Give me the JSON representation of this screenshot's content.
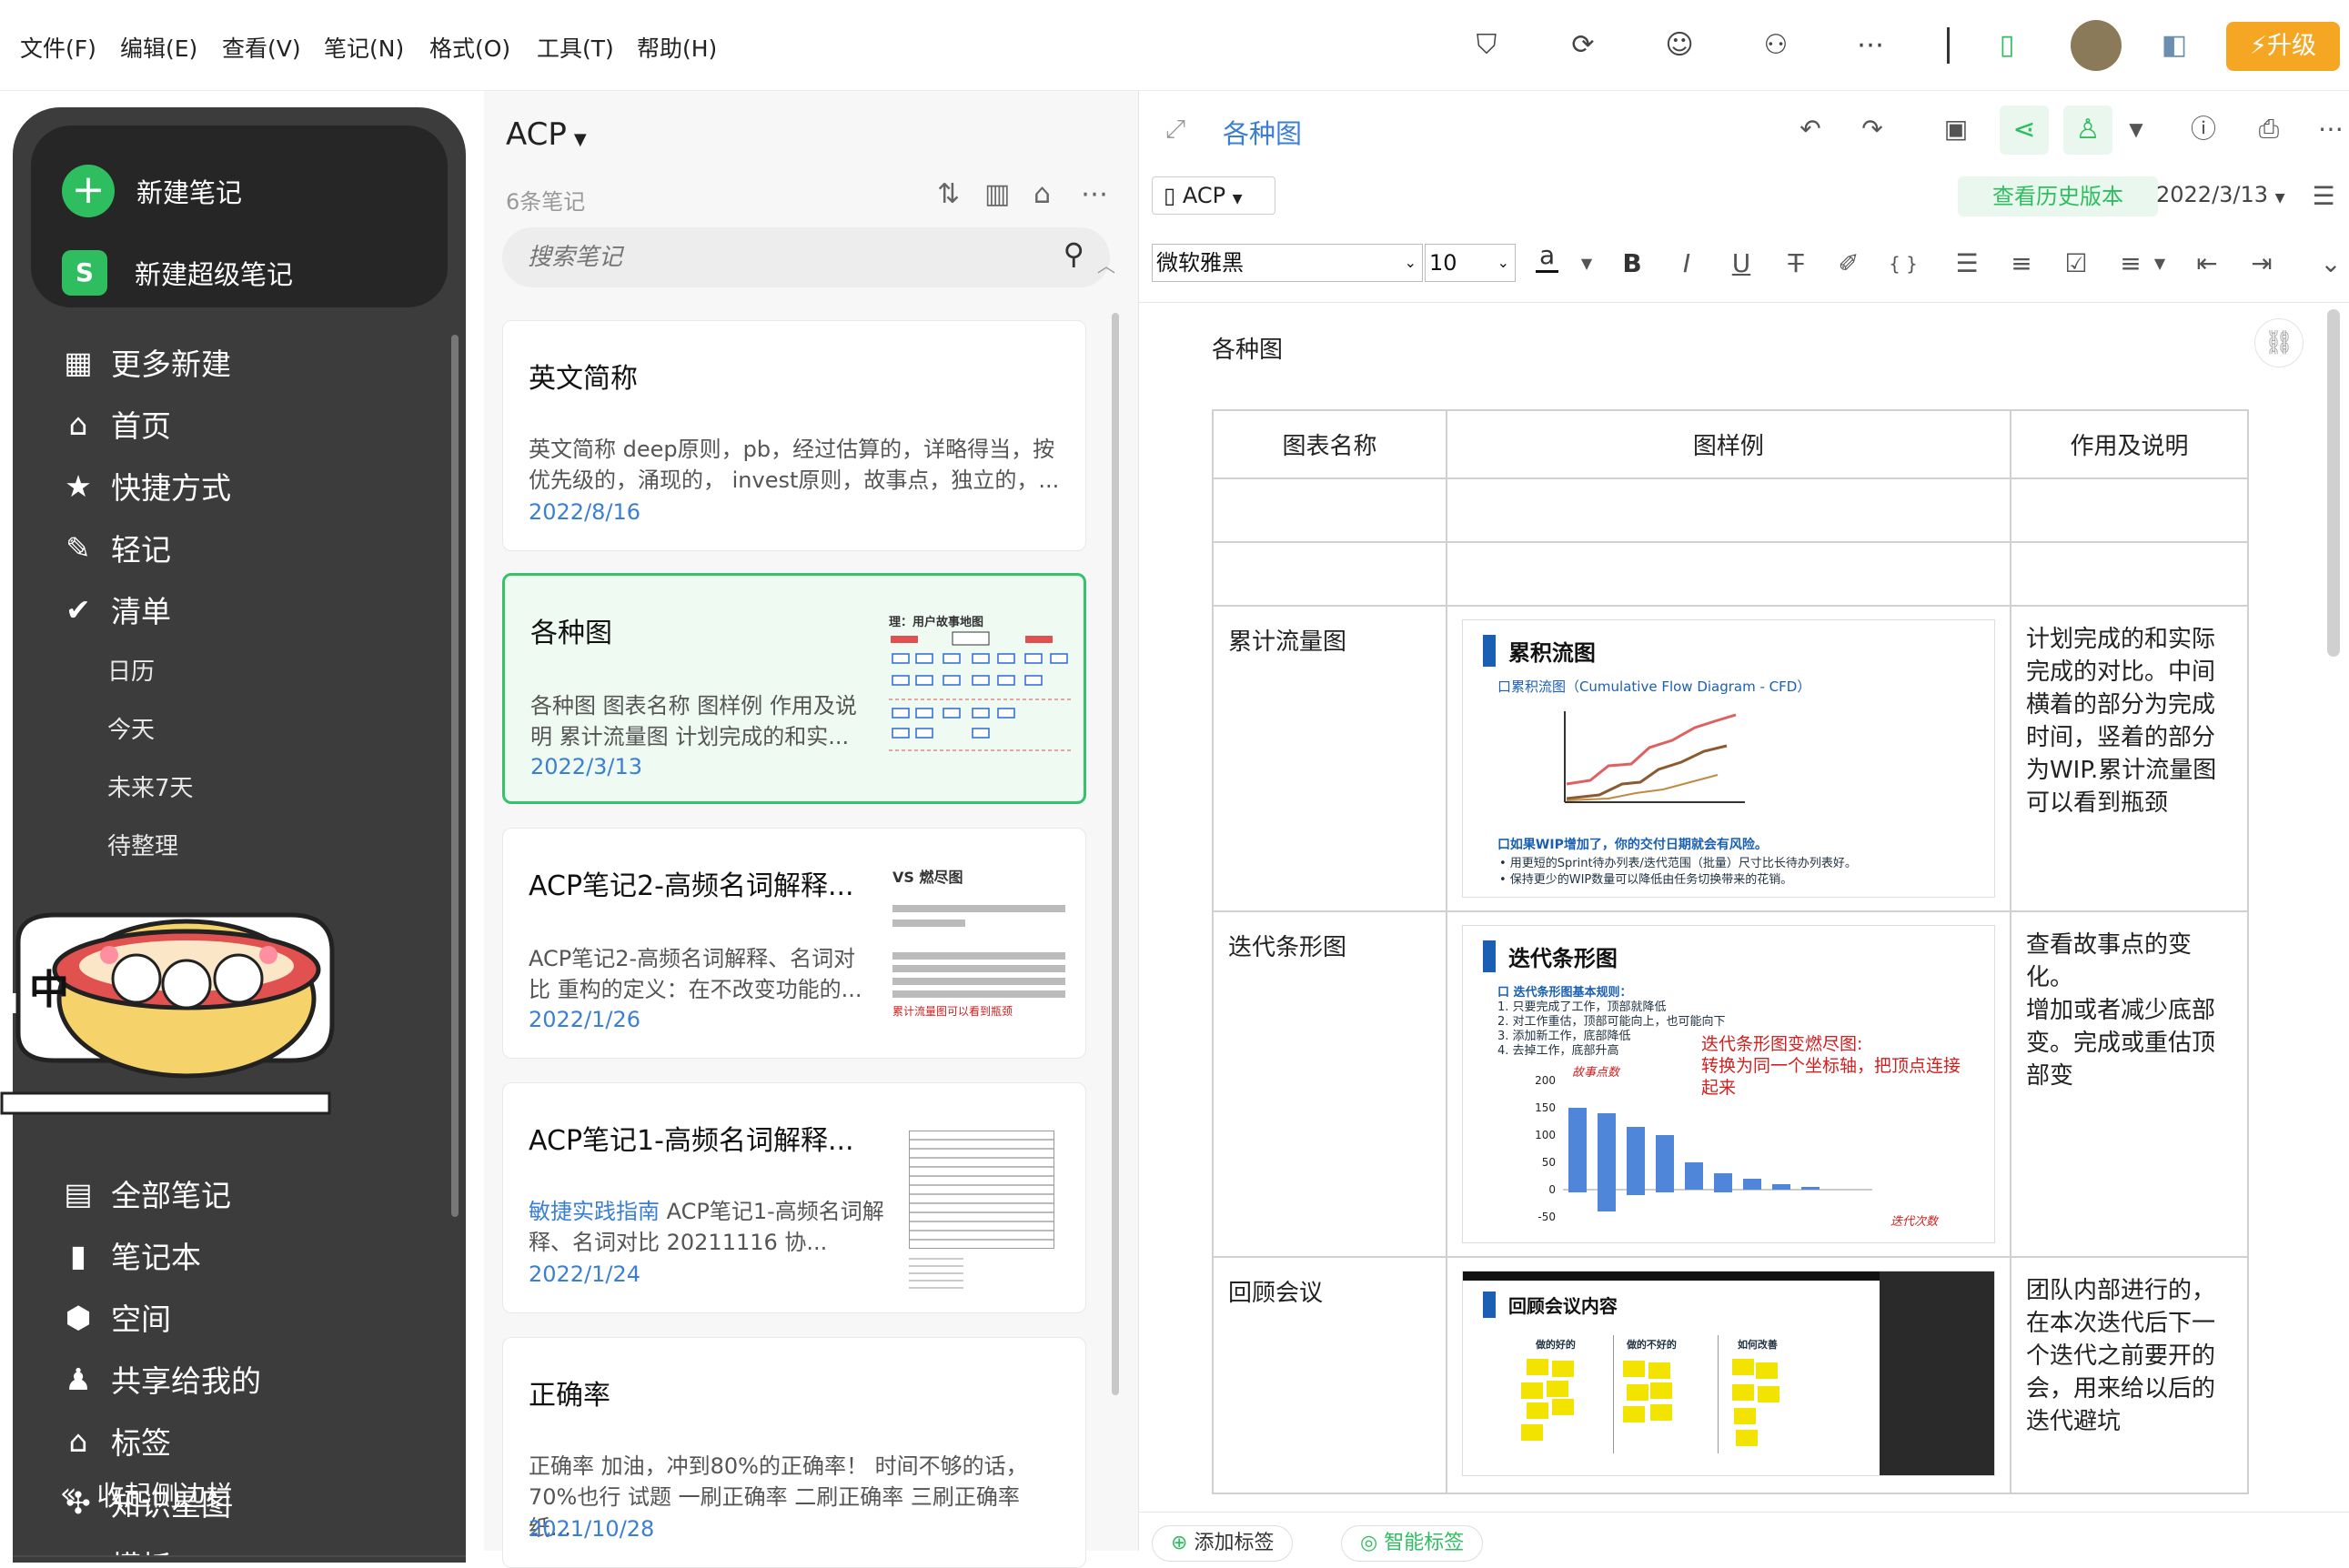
{
  "menubar": {
    "items": [
      "文件(F)",
      "编辑(E)",
      "查看(V)",
      "笔记(N)",
      "格式(O)",
      "工具(T)",
      "帮助(H)"
    ],
    "upgrade_label": "升级"
  },
  "sidebar": {
    "new_note": "新建笔记",
    "new_super_note": "新建超级笔记",
    "super_icon_letter": "S",
    "items": [
      {
        "label": "更多新建",
        "icon": "grid-icon"
      },
      {
        "label": "首页",
        "icon": "home-icon"
      },
      {
        "label": "快捷方式",
        "icon": "star-icon"
      },
      {
        "label": "轻记",
        "icon": "pen-icon"
      },
      {
        "label": "清单",
        "icon": "check-circle-icon"
      }
    ],
    "sub_items": [
      "日历",
      "今天",
      "未来7天",
      "待整理"
    ],
    "items2": [
      {
        "label": "全部笔记",
        "icon": "note-icon"
      },
      {
        "label": "笔记本",
        "icon": "notebook-icon"
      },
      {
        "label": "空间",
        "icon": "cube-icon"
      },
      {
        "label": "共享给我的",
        "icon": "users-icon"
      },
      {
        "label": "标签",
        "icon": "tag-icon"
      },
      {
        "label": "知识星图",
        "icon": "graph-icon"
      },
      {
        "label": "模板",
        "icon": "template-icon"
      }
    ],
    "collapse": "收起侧边栏",
    "mascot_char": "中"
  },
  "notelist": {
    "title": "ACP",
    "count": "6条笔记",
    "search_placeholder": "搜索笔记",
    "notes": [
      {
        "title": "英文简称",
        "snippet": "英文简称 deep原则，pb，经过估算的，详略得当，按优先级的，涌现的， invest原则，故事点，独立的，...",
        "date": "2022/8/16"
      },
      {
        "title": "各种图",
        "snippet": "各种图 图表名称 图样例 作用及说明 累计流量图 计划完成的和实...",
        "date": "2022/3/13",
        "thumb_title": "理：用户故事地图"
      },
      {
        "title": "ACP笔记2-高频名词解释...",
        "snippet": "ACP笔记2-高频名词解释、名词对比 重构的定义：在不改变功能的...",
        "date": "2022/1/26",
        "thumb_title": "VS 燃尽图",
        "thumb_red": "累计流量图可以看到瓶颈"
      },
      {
        "title": "ACP笔记1-高频名词解释...",
        "snippet_link": "敏捷实践指南",
        "snippet": " ACP笔记1-高频名词解释、名词对比 20211116 协...",
        "date": "2022/1/24"
      },
      {
        "title": "正确率",
        "snippet": "正确率 加油，冲到80%的正确率！ 时间不够的话，70%也行 试题 一刷正确率 二刷正确率 三刷正确率 纸...",
        "date": "2021/10/28"
      }
    ]
  },
  "editor": {
    "title": "各种图",
    "notebook": "ACP",
    "history_btn": "查看历史版本",
    "date": "2022/3/13",
    "font_name": "微软雅黑",
    "font_size": "10",
    "font_color_glyph": "a",
    "doc_heading": "各种图",
    "table": {
      "headers": [
        "图表名称",
        "图样例",
        "作用及说明"
      ],
      "rows": [
        {
          "name": "累计流量图",
          "desc": "计划完成的和实际完成的对比。中间横着的部分为完成时间，竖着的部分为WIP.累计流量图可以看到瓶颈",
          "fig_title": "累积流图",
          "fig_sub": "口累积流图（Cumulative Flow Diagram - CFD）",
          "fig_note": "口如果WIP增加了，你的交付日期就会有风险。",
          "fig_b1": "•  用更短的Sprint待办列表/迭代范围（批量）尺寸比长待办列表好。",
          "fig_b2": "•  保持更少的WIP数量可以降低由任务切换带来的花销。"
        },
        {
          "name": "迭代条形图",
          "desc": "查看故事点的变化。\n增加或者减少底部变。完成或重估顶部变",
          "fig_title": "迭代条形图",
          "fig_sub": "口 迭代条形图基本规则：",
          "fig_r1": "1. 只要完成了工作，顶部就降低",
          "fig_r2": "2. 对工作重估，顶部可能向上，也可能向下",
          "fig_r3": "3. 添加新工作，底部降低",
          "fig_r4": "4. 去掉工作，底部升高",
          "fig_red": "迭代条形图变燃尽图:\n转换为同一个坐标轴，把顶点连接起来",
          "y_label": "故事点数",
          "x_label": "迭代次数",
          "y_ticks": [
            "200",
            "150",
            "100",
            "50",
            "0",
            "-50"
          ]
        },
        {
          "name": "回顾会议",
          "desc": "团队内部进行的，在本次迭代后下一个迭代之前要开的会，用来给以后的迭代避坑",
          "fig_title": "回顾会议内容",
          "cols": [
            "做的好的",
            "做的不好的",
            "如何改善"
          ]
        }
      ]
    },
    "bottom_add_tag": "添加标签",
    "bottom_smart_tag": "智能标签"
  },
  "chart_data": {
    "type": "bar",
    "ylabel": "故事点数",
    "xlabel": "迭代次数",
    "ylim": [
      -50,
      200
    ],
    "values": [
      150,
      140,
      115,
      100,
      50,
      30,
      20,
      10,
      5
    ],
    "bottoms": [
      -5,
      -40,
      -10,
      -5,
      0,
      -5,
      0,
      0,
      0
    ]
  }
}
